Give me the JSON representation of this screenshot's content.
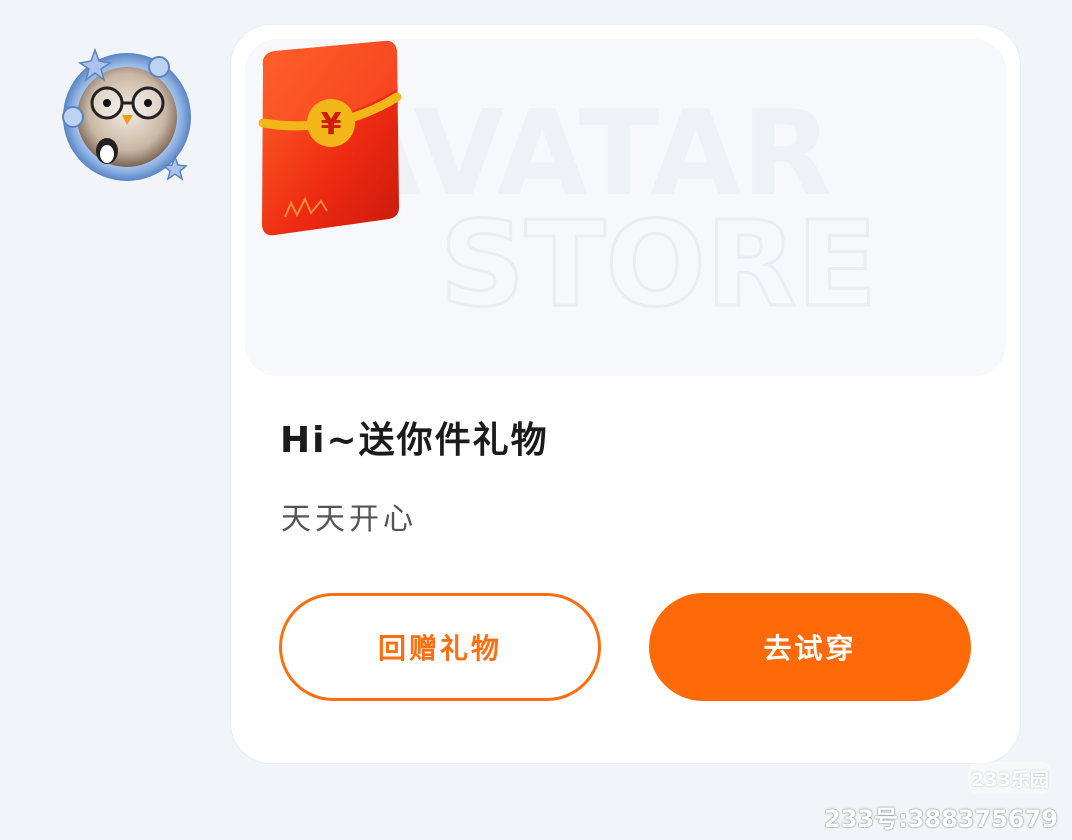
{
  "profile": {
    "avatar_icon": "penguin-avatar-icon"
  },
  "card": {
    "banner": {
      "watermark_line1": "AVATAR",
      "watermark_line2": "STORE",
      "gift_icon": "red-envelope-icon",
      "currency_symbol": "¥"
    },
    "title": "Hi~送你件礼物",
    "message": "天天开心",
    "return_gift_label": "回赠礼物",
    "try_on_label": "去试穿"
  },
  "watermark": {
    "logo": "233乐园",
    "id_text": "233号:388375679"
  },
  "colors": {
    "accent": "#ff6a08",
    "background": "#f1f4f8",
    "card": "#ffffff",
    "envelope_red": "#ee2a12",
    "envelope_gold": "#f4b71a"
  }
}
